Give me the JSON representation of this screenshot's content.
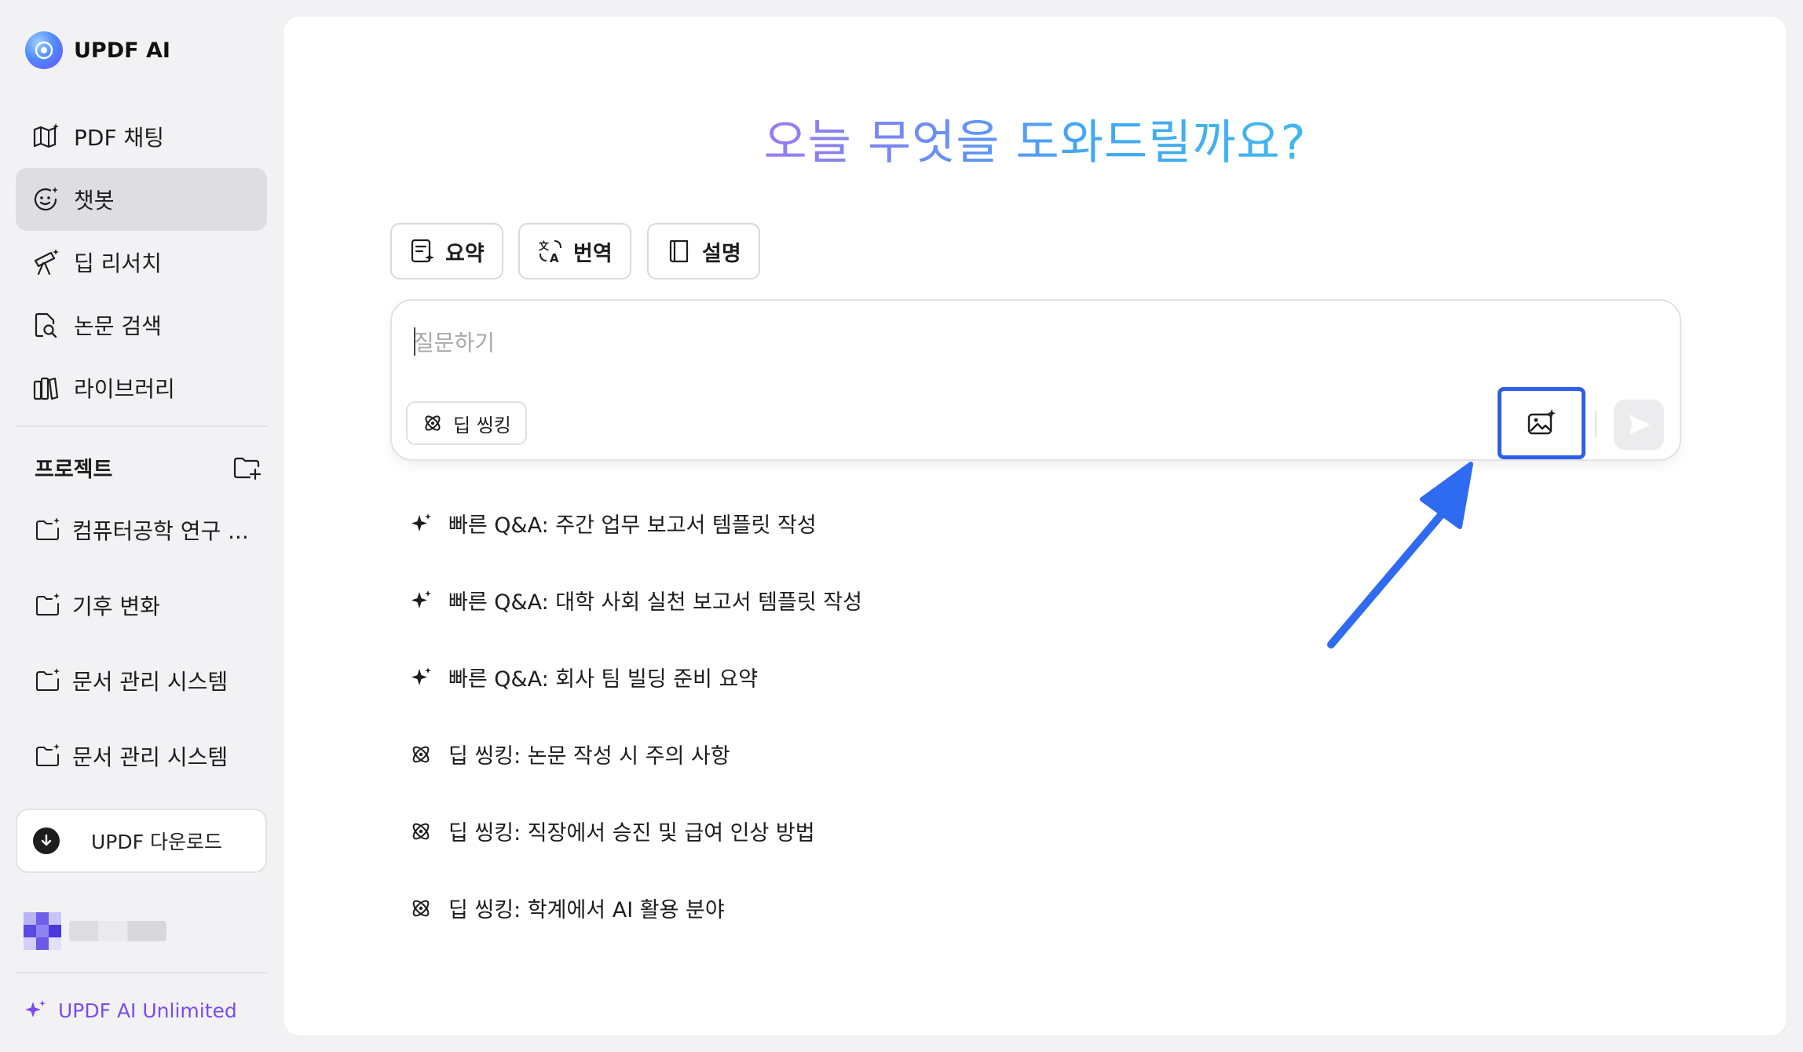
{
  "brand": {
    "name": "UPDF AI"
  },
  "nav": [
    {
      "label": "PDF 채팅",
      "icon": "map-sparkle-icon"
    },
    {
      "label": "챗봇",
      "icon": "chatbot-face-icon",
      "active": true
    },
    {
      "label": "딥 리서치",
      "icon": "telescope-icon"
    },
    {
      "label": "논문 검색",
      "icon": "document-search-icon"
    },
    {
      "label": "라이브러리",
      "icon": "library-books-icon"
    }
  ],
  "projects": {
    "title": "프로젝트",
    "items": [
      {
        "label": "컴퓨터공학 연구 ..."
      },
      {
        "label": "기후 변화"
      },
      {
        "label": "문서 관리 시스템"
      },
      {
        "label": "문서 관리 시스템"
      }
    ]
  },
  "download": {
    "label": "UPDF 다운로드"
  },
  "unlimited": {
    "label": "UPDF AI Unlimited"
  },
  "main": {
    "title": "오늘 무엇을 도와드릴까요?",
    "chips": [
      {
        "label": "요약",
        "icon": "summary-sparkle-icon"
      },
      {
        "label": "번역",
        "icon": "translate-icon"
      },
      {
        "label": "설명",
        "icon": "book-icon"
      }
    ],
    "input": {
      "placeholder": "질문하기",
      "value": ""
    },
    "deep_thinking": {
      "label": "딥 씽킹"
    },
    "suggestions": [
      {
        "label": "빠른 Q&A: 주간 업무 보고서 템플릿 작성",
        "icon": "sparkle-icon"
      },
      {
        "label": "빠른 Q&A: 대학 사회 실천 보고서 템플릿 작성",
        "icon": "sparkle-icon"
      },
      {
        "label": "빠른 Q&A: 회사 팀 빌딩 준비 요약",
        "icon": "sparkle-icon"
      },
      {
        "label": "딥 씽킹: 논문 작성 시 주의 사항",
        "icon": "atom-icon"
      },
      {
        "label": "딥 씽킹: 직장에서 승진 및 급여 인상 방법",
        "icon": "atom-icon"
      },
      {
        "label": "딥 씽킹: 학계에서 AI 활용 분야",
        "icon": "atom-icon"
      }
    ]
  },
  "colors": {
    "accent": "#2f5fe6",
    "arrow": "#2f6bf0",
    "unlimited": "#7a4cf0",
    "active_nav": "#dedee2"
  }
}
